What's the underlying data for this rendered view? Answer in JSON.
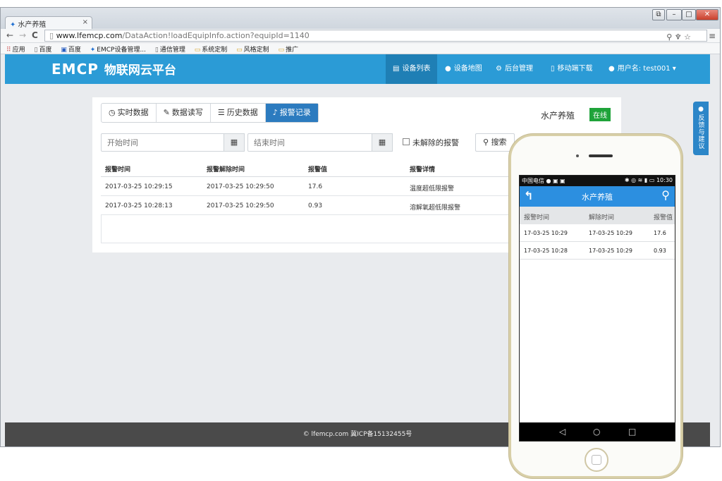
{
  "browser": {
    "tab_title": "水产养殖",
    "tab_close": "×",
    "url_host": "www.lfemcp.com",
    "url_path": "/DataAction!loadEquipInfo.action?equipId=1140",
    "bookmarks": [
      "应用",
      "百度",
      "百度",
      "EMCP设备管理...",
      "通信管理",
      "系统定制",
      "风格定制",
      "推广"
    ]
  },
  "header": {
    "logo": "EMCP",
    "logo_cn": "物联网云平台",
    "nav": {
      "device_list": "设备列表",
      "device_map": "设备地图",
      "backend": "后台管理",
      "mobile_download": "移动端下载",
      "user": "用户名: test001"
    }
  },
  "panel": {
    "tabs": {
      "realtime": "实时数据",
      "readwrite": "数据读写",
      "history": "历史数据",
      "alarms": "报警记录"
    },
    "device_name": "水产养殖",
    "status": "在线",
    "start_placeholder": "开始时间",
    "end_placeholder": "结束时间",
    "unresolved_label": "未解除的报警",
    "search_label": "搜索",
    "table": {
      "headers": [
        "报警时间",
        "报警解除时间",
        "报警值",
        "报警详情"
      ],
      "rows": [
        [
          "2017-03-25 10:29:15",
          "2017-03-25 10:29:50",
          "17.6",
          "温度超低限报警"
        ],
        [
          "2017-03-25 10:28:13",
          "2017-03-25 10:29:50",
          "0.93",
          "溶解氧超低限报警"
        ]
      ]
    }
  },
  "footer": {
    "text": "© lfemcp.com 冀ICP备15132455号"
  },
  "feedback": "反馈与建议",
  "phone": {
    "status_left": "中国电信",
    "status_right": "10:30",
    "title": "水产养殖",
    "headers": [
      "报警时间",
      "解除时间",
      "报警值"
    ],
    "rows": [
      [
        "17-03-25 10:29",
        "17-03-25 10:29",
        "17.6"
      ],
      [
        "17-03-25 10:28",
        "17-03-25 10:29",
        "0.93"
      ]
    ]
  },
  "colors": {
    "nav_blue": "#2b9bd6",
    "active_tab": "#2c7bbf",
    "online_green": "#1fa33a",
    "app_blue": "#2c8fe0"
  }
}
